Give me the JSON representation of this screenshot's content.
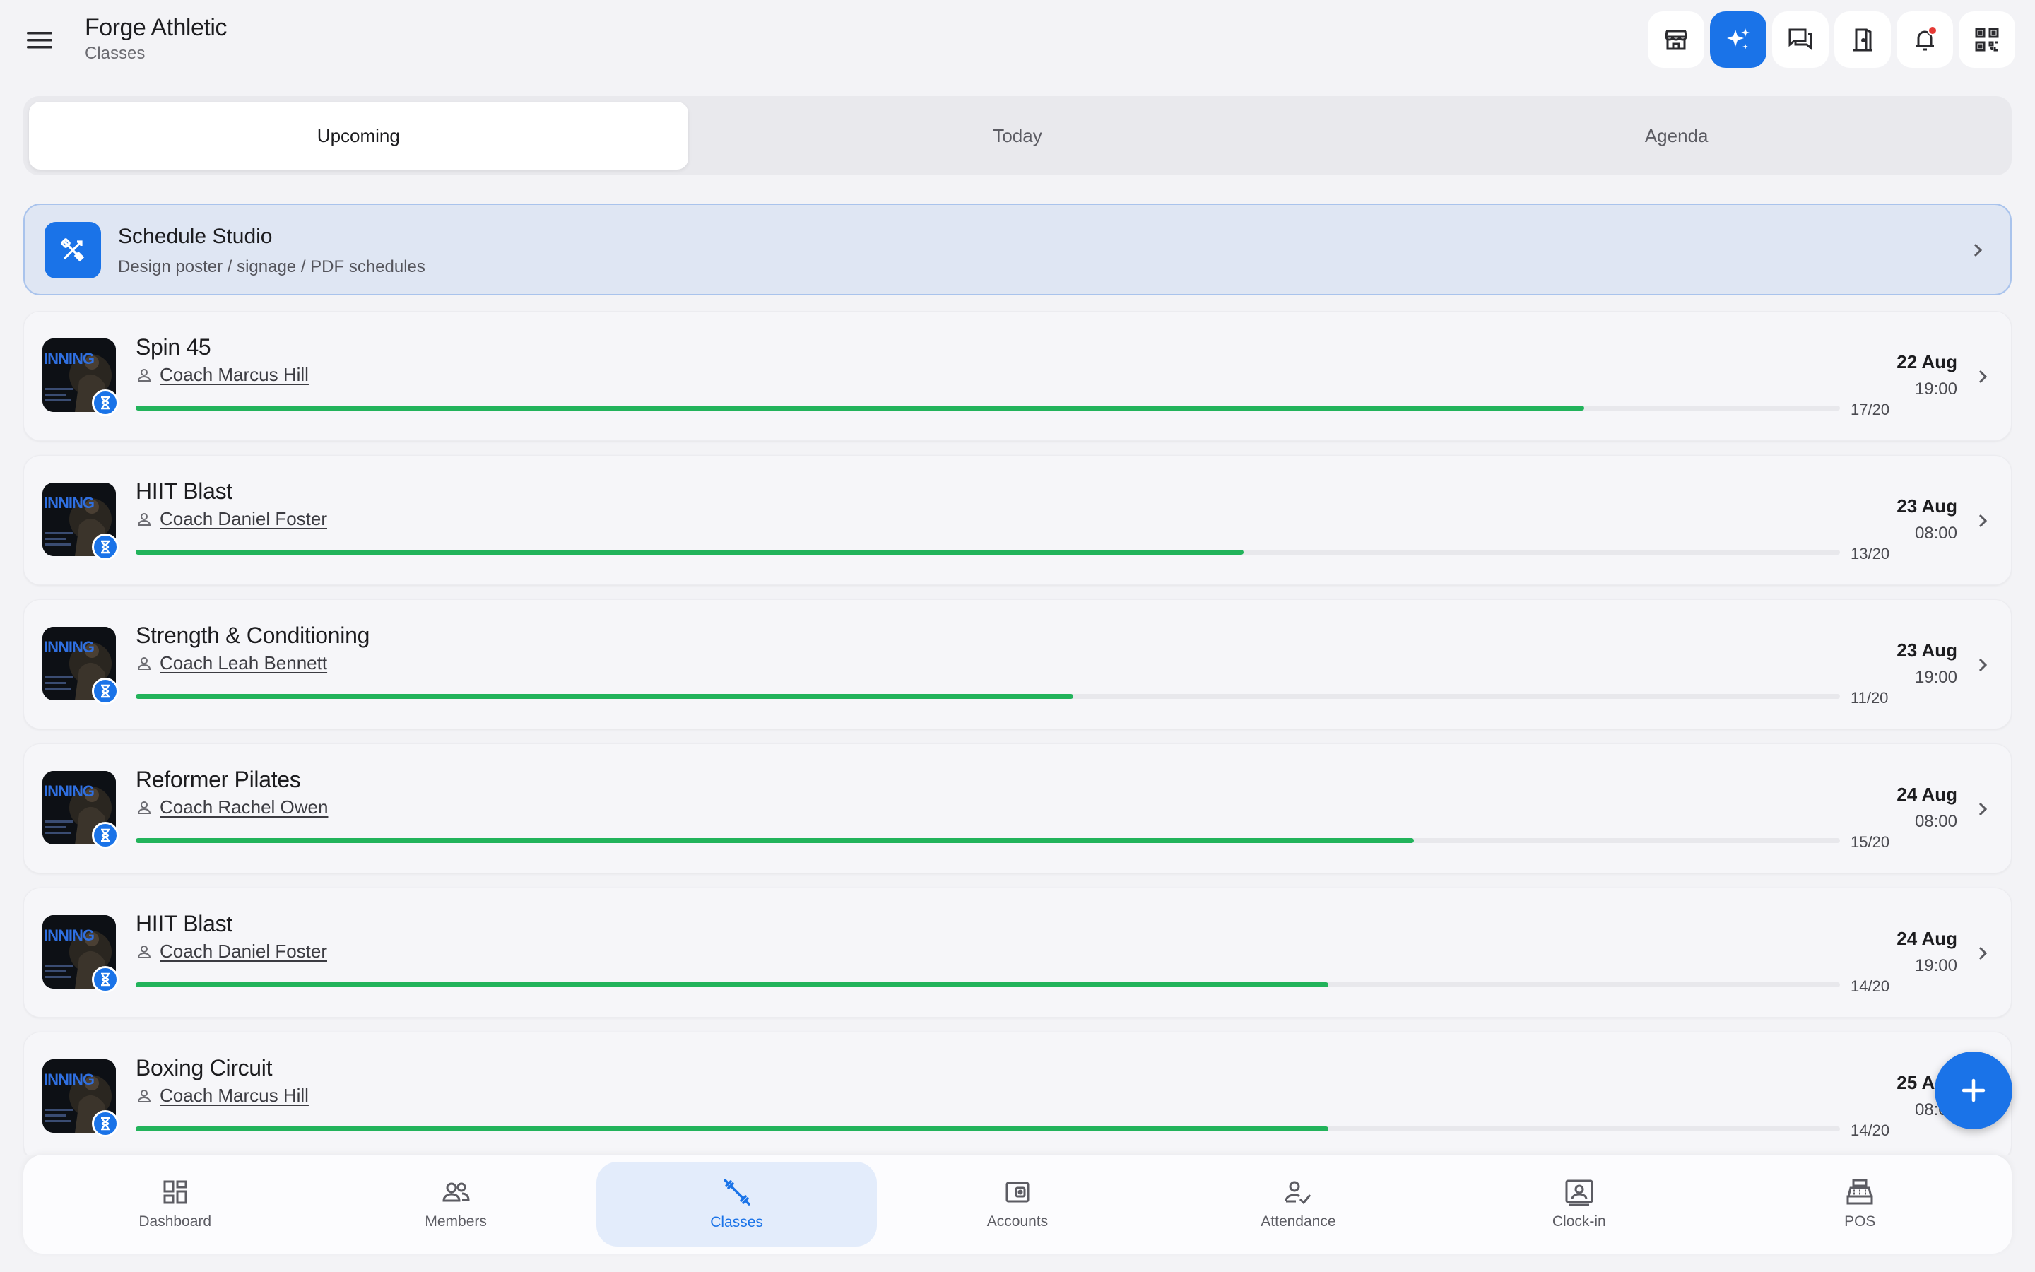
{
  "header": {
    "title": "Forge Athletic",
    "subtitle": "Classes",
    "buttons": [
      {
        "name": "storefront-icon"
      },
      {
        "name": "ai-sparkle-icon",
        "accent": true
      },
      {
        "name": "chat-icon"
      },
      {
        "name": "door-icon"
      },
      {
        "name": "bell-icon",
        "has_notification": true
      },
      {
        "name": "qr-code-icon"
      }
    ]
  },
  "tabs": [
    {
      "label": "Upcoming",
      "active": true
    },
    {
      "label": "Today",
      "active": false
    },
    {
      "label": "Agenda",
      "active": false
    }
  ],
  "studio": {
    "title": "Schedule Studio",
    "subtitle": "Design poster / signage / PDF schedules"
  },
  "classes": [
    {
      "name": "Spin 45",
      "coach": "Coach Marcus Hill",
      "booked": 17,
      "capacity": 20,
      "capacity_label": "17/20",
      "date": "22 Aug",
      "time": "19:00"
    },
    {
      "name": "HIIT Blast",
      "coach": "Coach Daniel Foster",
      "booked": 13,
      "capacity": 20,
      "capacity_label": "13/20",
      "date": "23 Aug",
      "time": "08:00"
    },
    {
      "name": "Strength & Conditioning",
      "coach": "Coach Leah Bennett",
      "booked": 11,
      "capacity": 20,
      "capacity_label": "11/20",
      "date": "23 Aug",
      "time": "19:00"
    },
    {
      "name": "Reformer Pilates",
      "coach": "Coach Rachel Owen",
      "booked": 15,
      "capacity": 20,
      "capacity_label": "15/20",
      "date": "24 Aug",
      "time": "08:00"
    },
    {
      "name": "HIIT Blast",
      "coach": "Coach Daniel Foster",
      "booked": 14,
      "capacity": 20,
      "capacity_label": "14/20",
      "date": "24 Aug",
      "time": "19:00"
    },
    {
      "name": "Boxing Circuit",
      "coach": "Coach Marcus Hill",
      "booked": 14,
      "capacity": 20,
      "capacity_label": "14/20",
      "date": "25 Aug",
      "time": "08:00"
    }
  ],
  "thumbnail_text": "INNING",
  "nav": [
    {
      "label": "Dashboard",
      "icon": "dashboard-icon",
      "active": false
    },
    {
      "label": "Members",
      "icon": "members-icon",
      "active": false
    },
    {
      "label": "Classes",
      "icon": "dumbbell-icon",
      "active": true
    },
    {
      "label": "Accounts",
      "icon": "wallet-icon",
      "active": false
    },
    {
      "label": "Attendance",
      "icon": "attendance-icon",
      "active": false
    },
    {
      "label": "Clock-in",
      "icon": "clock-in-icon",
      "active": false
    },
    {
      "label": "POS",
      "icon": "cash-register-icon",
      "active": false
    }
  ],
  "colors": {
    "accent": "#1a73e8",
    "progress": "#22b35b",
    "background": "#f3f3f6",
    "studio_bg": "#dfe6f3",
    "notification": "#e53935"
  }
}
